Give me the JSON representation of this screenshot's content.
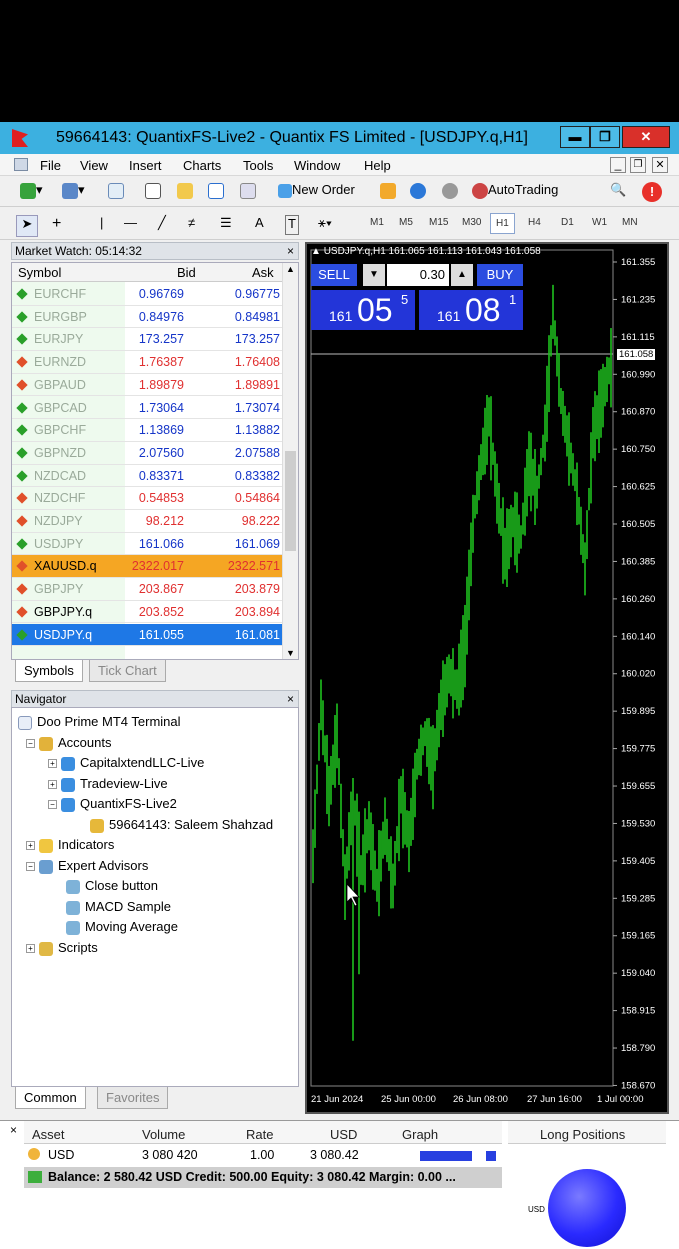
{
  "window": {
    "title": "59664143: QuantixFS-Live2 - Quantix FS Limited - [USDJPY.q,H1]",
    "minimize": "▬",
    "restore": "❐",
    "close": "✕"
  },
  "menu": [
    "File",
    "View",
    "Insert",
    "Charts",
    "Tools",
    "Window",
    "Help"
  ],
  "toolbar": {
    "new_order": "New Order",
    "autotrading": "AutoTrading"
  },
  "timeframes": [
    "M1",
    "M5",
    "M15",
    "M30",
    "H1",
    "H4",
    "D1",
    "W1",
    "MN"
  ],
  "active_timeframe": "H1",
  "market_watch": {
    "title": "Market Watch: 05:14:32",
    "headers": {
      "symbol": "Symbol",
      "bid": "Bid",
      "ask": "Ask"
    },
    "rows": [
      {
        "symbol": "EURCHF",
        "bid": "0.96769",
        "ask": "0.96775",
        "dir": "up",
        "faded": true
      },
      {
        "symbol": "EURGBP",
        "bid": "0.84976",
        "ask": "0.84981",
        "dir": "up",
        "faded": true
      },
      {
        "symbol": "EURJPY",
        "bid": "173.257",
        "ask": "173.257",
        "dir": "up",
        "faded": true
      },
      {
        "symbol": "EURNZD",
        "bid": "1.76387",
        "ask": "1.76408",
        "dir": "down",
        "faded": true
      },
      {
        "symbol": "GBPAUD",
        "bid": "1.89879",
        "ask": "1.89891",
        "dir": "down",
        "faded": true
      },
      {
        "symbol": "GBPCAD",
        "bid": "1.73064",
        "ask": "1.73074",
        "dir": "up",
        "faded": true
      },
      {
        "symbol": "GBPCHF",
        "bid": "1.13869",
        "ask": "1.13882",
        "dir": "up",
        "faded": true
      },
      {
        "symbol": "GBPNZD",
        "bid": "2.07560",
        "ask": "2.07588",
        "dir": "up",
        "faded": true
      },
      {
        "symbol": "NZDCAD",
        "bid": "0.83371",
        "ask": "0.83382",
        "dir": "up",
        "faded": true
      },
      {
        "symbol": "NZDCHF",
        "bid": "0.54853",
        "ask": "0.54864",
        "dir": "down",
        "faded": true
      },
      {
        "symbol": "NZDJPY",
        "bid": "98.212",
        "ask": "98.222",
        "dir": "down",
        "faded": true
      },
      {
        "symbol": "USDJPY",
        "bid": "161.066",
        "ask": "161.069",
        "dir": "up",
        "faded": true
      },
      {
        "symbol": "XAUUSD.q",
        "bid": "2322.017",
        "ask": "2322.571",
        "dir": "down",
        "faded": false,
        "highlight": "orange"
      },
      {
        "symbol": "GBPJPY",
        "bid": "203.867",
        "ask": "203.879",
        "dir": "down",
        "faded": true
      },
      {
        "symbol": "GBPJPY.q",
        "bid": "203.852",
        "ask": "203.894",
        "dir": "down",
        "faded": false
      },
      {
        "symbol": "USDJPY.q",
        "bid": "161.055",
        "ask": "161.081",
        "dir": "up",
        "faded": false,
        "highlight": "blue"
      }
    ],
    "tabs": [
      "Symbols",
      "Tick Chart"
    ]
  },
  "navigator": {
    "title": "Navigator",
    "root": "Doo Prime MT4 Terminal",
    "accounts_label": "Accounts",
    "accounts": [
      "CapitalxtendLLC-Live",
      "Tradeview-Live",
      "QuantixFS-Live2"
    ],
    "account_user": "59664143: Saleem Shahzad",
    "indicators": "Indicators",
    "expert_advisors": "Expert Advisors",
    "experts": [
      "Close button",
      "MACD Sample",
      "Moving Average"
    ],
    "scripts": "Scripts",
    "tabs": [
      "Common",
      "Favorites"
    ]
  },
  "chart": {
    "header": "USDJPY.q,H1  161.065 161.113 161.043 161.058",
    "sell_label": "SELL",
    "buy_label": "BUY",
    "lot": "0.30",
    "sell_big": "05",
    "sell_small": "161",
    "sell_sup": "5",
    "buy_big": "08",
    "buy_small": "161",
    "buy_sup": "1",
    "price_labels": [
      "161.355",
      "161.235",
      "161.115",
      "160.990",
      "160.870",
      "160.750",
      "160.625",
      "160.505",
      "160.385",
      "160.260",
      "160.140",
      "160.020",
      "159.895",
      "159.775",
      "159.655",
      "159.530",
      "159.405",
      "159.285",
      "159.165",
      "159.040",
      "158.915",
      "158.790",
      "158.670"
    ],
    "current_price": "161.058",
    "time_labels": [
      "21 Jun 2024",
      "25 Jun 00:00",
      "26 Jun 08:00",
      "27 Jun 16:00",
      "1 Jul 00:00"
    ],
    "bar_color": "#1fc01f"
  },
  "terminal": {
    "headers": [
      "Asset",
      "Volume",
      "Rate",
      "USD",
      "Graph",
      "Long Positions"
    ],
    "row": {
      "asset": "USD",
      "volume": "3 080 420",
      "rate": "1.00",
      "usd": "3 080.42"
    },
    "balance": "Balance: 2 580.42 USD  Credit: 500.00  Equity: 3 080.42  Margin: 0.00  ...",
    "pie_label": "USD"
  }
}
